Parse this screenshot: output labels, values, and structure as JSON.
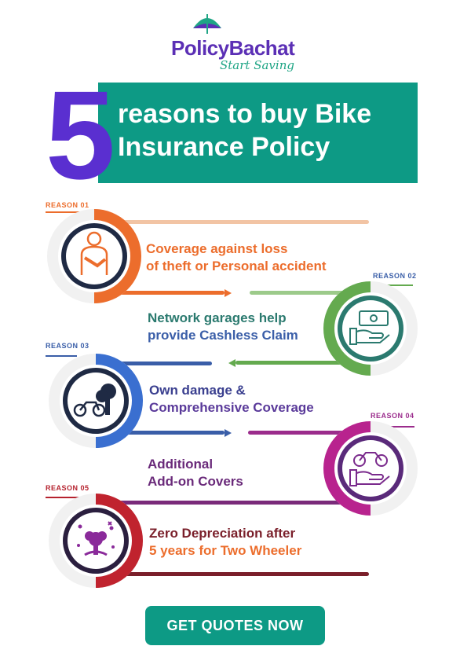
{
  "brand": {
    "name": "PolicyBachat",
    "tagline": "Start Saving",
    "colors": {
      "purple": "#5b2fb5",
      "teal": "#0d9a85",
      "green": "#1fa585"
    },
    "icon": "umbrella-icon"
  },
  "header": {
    "number": "5",
    "title_line1": "reasons to buy Bike",
    "title_line2": "Insurance Policy"
  },
  "reasons": [
    {
      "tag": "REASON 01",
      "line1": "Coverage against loss",
      "line2": "of theft or Personal accident",
      "color": "#ec6d2c",
      "icon": "injured-person-icon"
    },
    {
      "tag": "REASON 02",
      "line1": "Network garages help",
      "line2": "provide Cashless Claim",
      "color": "#64aa4f",
      "icon": "cash-in-hand-icon"
    },
    {
      "tag": "REASON 03",
      "line1": "Own damage &",
      "line2": "Comprehensive Coverage",
      "color": "#3a5ea8",
      "icon": "bike-crash-icon"
    },
    {
      "tag": "REASON 04",
      "line1": "Additional",
      "line2": "Add-on Covers",
      "color": "#9b2c8c",
      "icon": "bike-in-hand-icon"
    },
    {
      "tag": "REASON 05",
      "line1": "Zero Depreciation after",
      "line2": "5 years for Two Wheeler",
      "color": "#b5222e",
      "icon": "zero-depreciation-icon"
    }
  ],
  "cta": {
    "label": "GET QUOTES NOW"
  }
}
